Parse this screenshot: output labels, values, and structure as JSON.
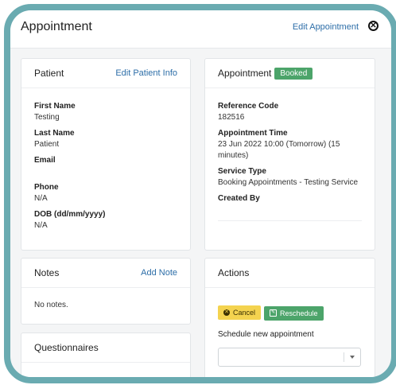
{
  "header": {
    "title": "Appointment",
    "edit_link": "Edit Appointment",
    "close_glyph": "✕"
  },
  "patient": {
    "title": "Patient",
    "edit_link": "Edit Patient Info",
    "fields": [
      {
        "label": "First Name",
        "value": "Testing"
      },
      {
        "label": "Last Name",
        "value": "Patient"
      },
      {
        "label": "Email",
        "value": ""
      },
      {
        "label": "Phone",
        "value": "N/A"
      },
      {
        "label": "DOB (dd/mm/yyyy)",
        "value": "N/A"
      }
    ]
  },
  "appointment": {
    "title": "Appointment",
    "status": "Booked",
    "fields": [
      {
        "label": "Reference Code",
        "value": "182516"
      },
      {
        "label": "Appointment Time",
        "value": "23 Jun 2022 10:00 (Tomorrow) (15 minutes)"
      },
      {
        "label": "Service Type",
        "value": "Booking Appointments - Testing Service"
      },
      {
        "label": "Created By",
        "value": ""
      }
    ]
  },
  "notes": {
    "title": "Notes",
    "add_link": "Add Note",
    "empty_text": "No notes."
  },
  "questionnaires": {
    "title": "Questionnaires"
  },
  "actions": {
    "title": "Actions",
    "cancel_label": "Cancel",
    "reschedule_label": "Reschedule",
    "schedule_label": "Schedule new appointment",
    "select_value": ""
  },
  "colors": {
    "frame": "#6aabb1",
    "link": "#2d6ea8",
    "success": "#4ca46a",
    "warning": "#f4d34f"
  }
}
